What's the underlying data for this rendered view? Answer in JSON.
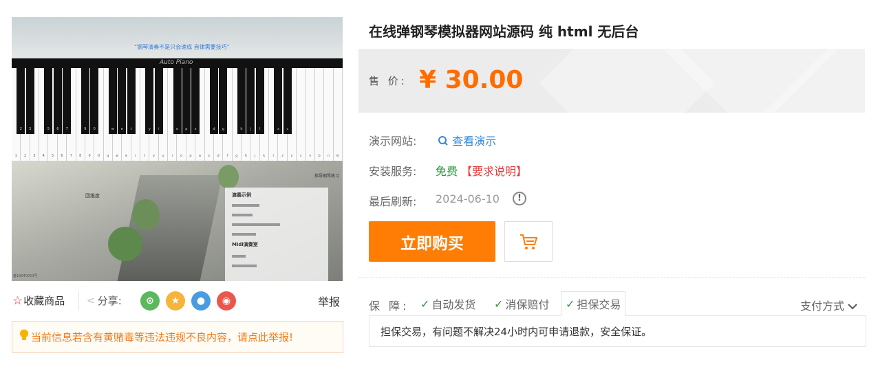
{
  "image": {
    "banner_text": "“钢琴演奏不是只会速成 自律需要技巧”",
    "keyboard_title": "Auto Piano",
    "caption_left": "回维度",
    "side_tag": "指导钢琴练习",
    "panel": {
      "heading1": "演奏示例",
      "heading2": "Midi演奏室"
    },
    "icp": "备19040053号",
    "white_labels": [
      "1",
      "2",
      "3",
      "4",
      "5",
      "6",
      "7",
      "8",
      "9",
      "0",
      "q",
      "w",
      "e",
      "r",
      "t",
      "y",
      "u",
      "i",
      "o",
      "p",
      "a",
      "s",
      "d",
      "f",
      "g",
      "h",
      "j",
      "k",
      "l",
      "z",
      "x",
      "c",
      "v",
      "b",
      "n",
      "m"
    ],
    "black_labels": [
      "2",
      "3",
      "5",
      "6",
      "7",
      "9",
      "0",
      "w",
      "e",
      "t",
      "y",
      "i",
      "o",
      "p",
      "s",
      "d",
      "g",
      "h",
      "j",
      "l",
      "z",
      "c"
    ]
  },
  "actions": {
    "favorite": "收藏商品",
    "share": "分享:",
    "report": "举报",
    "warning": "当前信息若含有黄赌毒等违法违规不良内容，请点此举报!"
  },
  "product": {
    "title": "在线弹钢琴模拟器网站源码 纯 html 无后台",
    "price_label": "售 价:",
    "price": "¥ 30.00",
    "demo_label": "演示网站:",
    "demo_link": "查看演示",
    "install_label": "安装服务:",
    "install_free": "免费",
    "install_req": "【要求说明】",
    "refresh_label": "最后刷新:",
    "refresh_date": "2024-06-10",
    "buy_label": "立即购买"
  },
  "guarantee": {
    "label": "保 障:",
    "items": [
      "自动发货",
      "消保赔付",
      "担保交易"
    ],
    "pay_methods": "支付方式",
    "description": "担保交易，有问题不解决24小时内可申请退款，安全保证。"
  },
  "colors": {
    "accent": "#ff7d05",
    "price": "#ff6c00",
    "link": "#3087d6",
    "ok": "#2b9939",
    "danger": "#e4393c"
  }
}
